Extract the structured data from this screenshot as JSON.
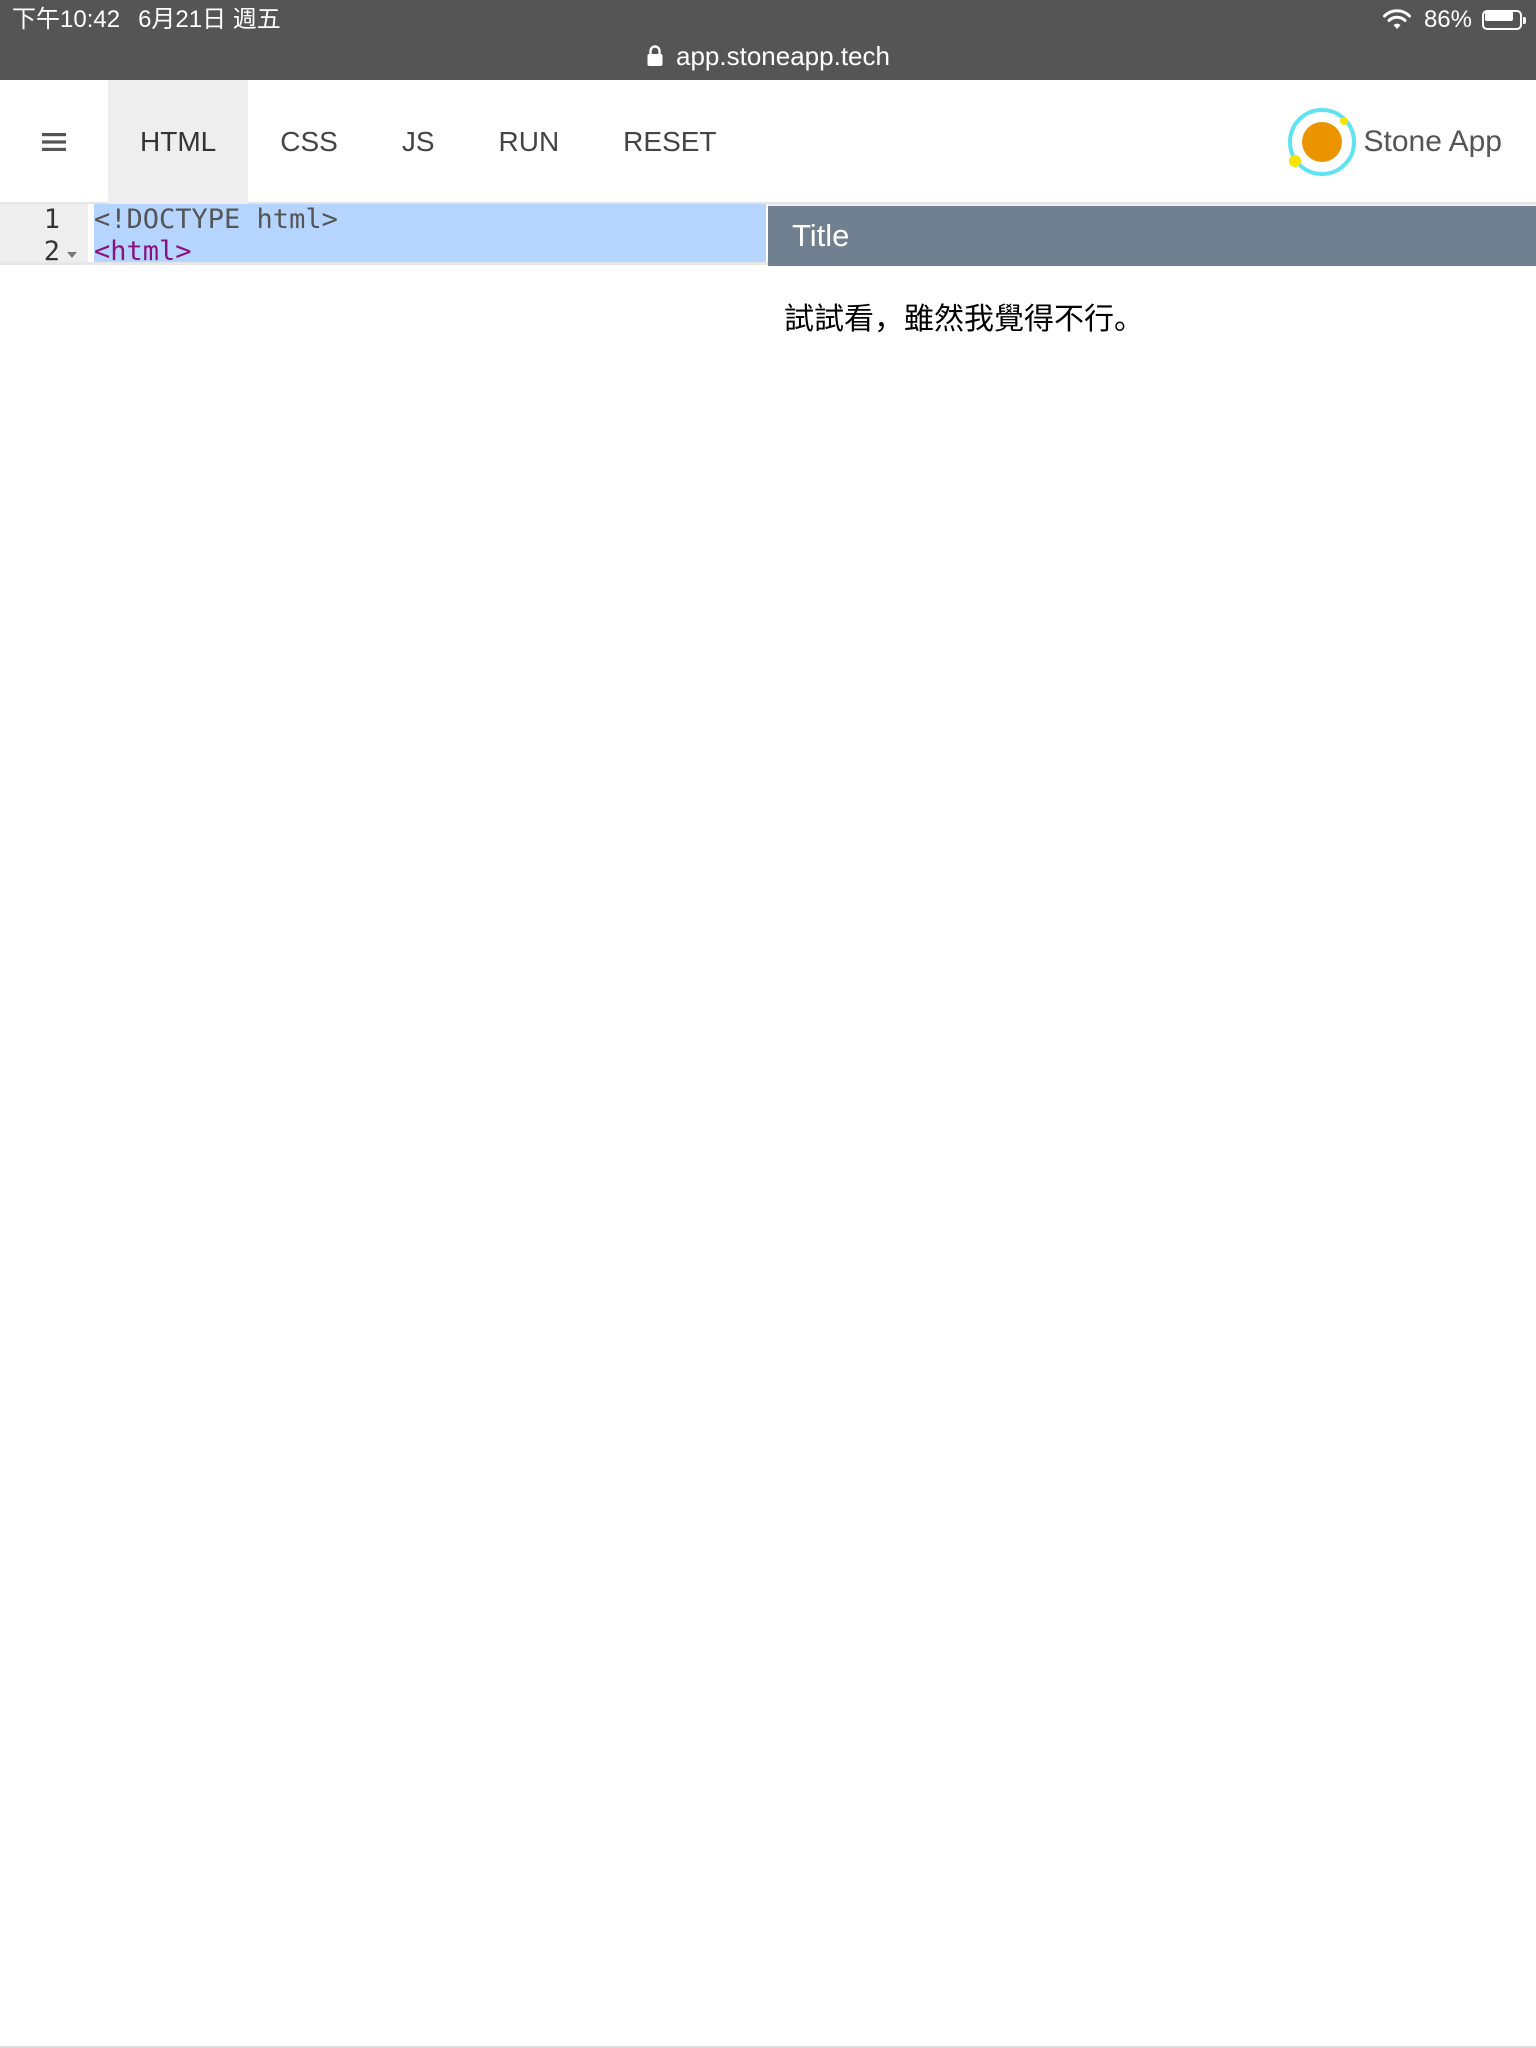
{
  "status_bar": {
    "time": "下午10:42",
    "date": "6月21日 週五",
    "battery_percent": "86%",
    "battery_level": 0.86,
    "wifi_icon": "wifi-icon",
    "battery_icon": "battery-icon"
  },
  "browser": {
    "url": "app.stoneapp.tech",
    "lock_icon": "lock-icon"
  },
  "nav": {
    "menu_icon": "hamburger-menu-icon",
    "tabs": [
      {
        "label": "HTML",
        "active": true
      },
      {
        "label": "CSS",
        "active": false
      },
      {
        "label": "JS",
        "active": false
      },
      {
        "label": "RUN",
        "active": false
      },
      {
        "label": "RESET",
        "active": false
      }
    ],
    "brand_name": "Stone App",
    "brand_logo": "stone-app-logo"
  },
  "editor": {
    "line_numbers": [
      "1",
      "2"
    ],
    "lines": [
      {
        "text": "<!DOCTYPE html>",
        "token": "meta"
      },
      {
        "text": "<html>",
        "token": "tag"
      }
    ],
    "selection_color": "#b5d5ff"
  },
  "preview": {
    "title": "Title",
    "header_color": "#708090",
    "body_text": "試試看，雖然我覺得不行。"
  }
}
